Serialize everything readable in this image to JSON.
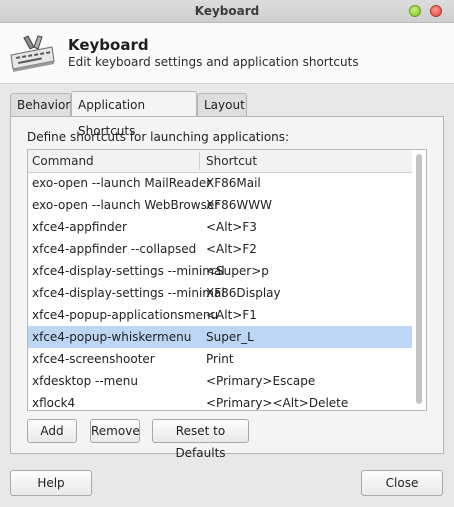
{
  "window": {
    "title": "Keyboard",
    "controls": [
      "minimize-icon",
      "close-icon"
    ]
  },
  "header": {
    "icon": "keyboard-icon",
    "title": "Keyboard",
    "subtitle": "Edit keyboard settings and application shortcuts"
  },
  "tabs": [
    {
      "label": "Behavior",
      "active": false
    },
    {
      "label": "Application Shortcuts",
      "active": true
    },
    {
      "label": "Layout",
      "active": false
    }
  ],
  "panel": {
    "define_label": "Define shortcuts for launching applications:",
    "columns": {
      "command": "Command",
      "shortcut": "Shortcut"
    },
    "rows": [
      {
        "command": "exo-open --launch MailReader",
        "shortcut": "XF86Mail"
      },
      {
        "command": "exo-open --launch WebBrowser",
        "shortcut": "XF86WWW"
      },
      {
        "command": "xfce4-appfinder",
        "shortcut": "<Alt>F3"
      },
      {
        "command": "xfce4-appfinder --collapsed",
        "shortcut": "<Alt>F2"
      },
      {
        "command": "xfce4-display-settings --minimal",
        "shortcut": "<Super>p"
      },
      {
        "command": "xfce4-display-settings --minimal",
        "shortcut": "XF86Display"
      },
      {
        "command": "xfce4-popup-applicationsmenu",
        "shortcut": "<Alt>F1"
      },
      {
        "command": "xfce4-popup-whiskermenu",
        "shortcut": "Super_L",
        "selected": true
      },
      {
        "command": "xfce4-screenshooter",
        "shortcut": "Print"
      },
      {
        "command": "xfdesktop --menu",
        "shortcut": "<Primary>Escape"
      },
      {
        "command": "xflock4",
        "shortcut": "<Primary><Alt>Delete"
      }
    ],
    "buttons": {
      "add": "Add",
      "remove": "Remove",
      "reset": "Reset to Defaults"
    }
  },
  "footer": {
    "help": "Help",
    "close": "Close"
  },
  "colors": {
    "selection": "#bcd6f3",
    "minimize": "#7cc21f",
    "close": "#e2443a"
  }
}
